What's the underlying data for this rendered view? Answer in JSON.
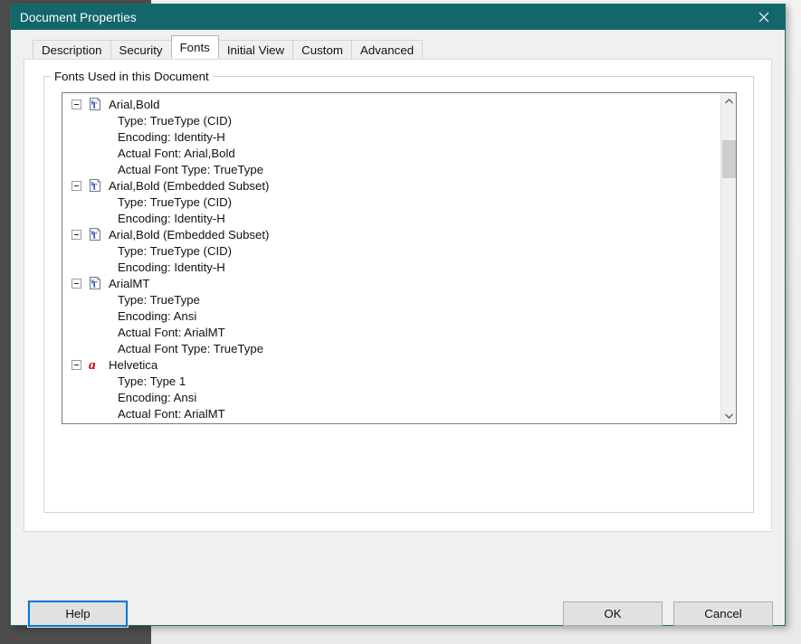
{
  "window": {
    "title": "Document Properties",
    "close_icon": "close-icon"
  },
  "tabs": [
    {
      "label": "Description",
      "selected": false
    },
    {
      "label": "Security",
      "selected": false
    },
    {
      "label": "Fonts",
      "selected": true
    },
    {
      "label": "Initial View",
      "selected": false
    },
    {
      "label": "Custom",
      "selected": false
    },
    {
      "label": "Advanced",
      "selected": false
    }
  ],
  "fonts_panel": {
    "group_label": "Fonts Used in this Document",
    "entries": [
      {
        "name": "Arial,Bold",
        "icon": "truetype-font-icon",
        "details": [
          "Type: TrueType (CID)",
          "Encoding: Identity-H",
          "Actual Font: Arial,Bold",
          "Actual Font Type: TrueType"
        ]
      },
      {
        "name": "Arial,Bold (Embedded Subset)",
        "icon": "truetype-font-icon",
        "details": [
          "Type: TrueType (CID)",
          "Encoding: Identity-H"
        ]
      },
      {
        "name": "Arial,Bold (Embedded Subset)",
        "icon": "truetype-font-icon",
        "details": [
          "Type: TrueType (CID)",
          "Encoding: Identity-H"
        ]
      },
      {
        "name": "ArialMT",
        "icon": "truetype-font-icon",
        "details": [
          "Type: TrueType",
          "Encoding: Ansi",
          "Actual Font: ArialMT",
          "Actual Font Type: TrueType"
        ]
      },
      {
        "name": "Helvetica",
        "icon": "type1-font-icon",
        "details": [
          "Type: Type 1",
          "Encoding: Ansi",
          "Actual Font: ArialMT"
        ]
      }
    ]
  },
  "buttons": {
    "help": "Help",
    "ok": "OK",
    "cancel": "Cancel"
  },
  "colors": {
    "titlebar": "#13666b",
    "focus_ring": "#0078d7",
    "truetype_icon": "#1a3fb0",
    "type1_icon": "#cc0000",
    "dialog_face": "#f0f0f0"
  }
}
